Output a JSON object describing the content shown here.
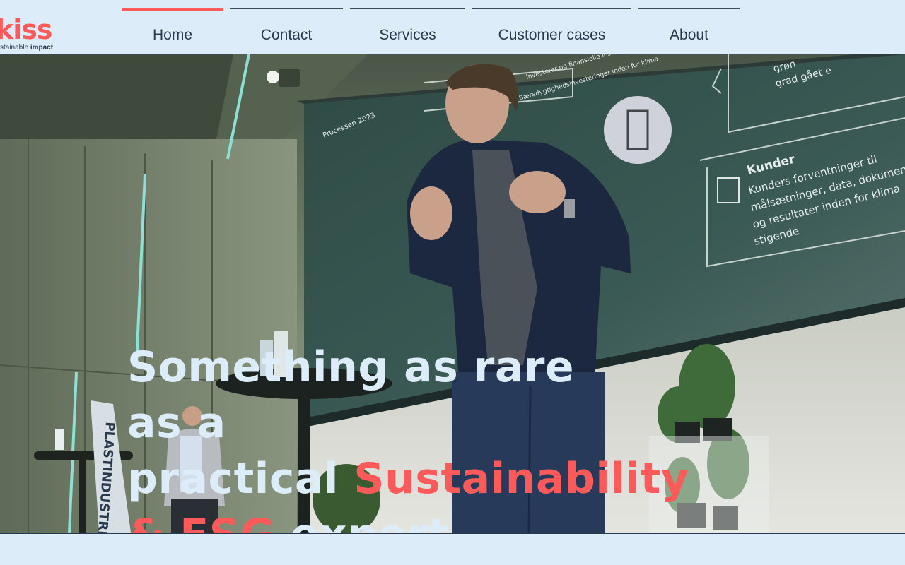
{
  "brand": {
    "logo_text": "kiss",
    "tagline_prefix": "stainable",
    "tagline_emphasis": "impact",
    "accent_color": "#ff5a5a",
    "text_color": "#2a3a4e",
    "background_color": "#dcecf9"
  },
  "nav": {
    "items": [
      {
        "label": "Home",
        "active": true
      },
      {
        "label": "Contact",
        "active": false
      },
      {
        "label": "Services",
        "active": false
      },
      {
        "label": "Customer cases",
        "active": false
      },
      {
        "label": "About",
        "active": false
      }
    ]
  },
  "hero": {
    "headline": {
      "line1": "Something as rare as a",
      "line2_plain": "practical ",
      "line2_accent": "Sustainability",
      "line3_accent": "& ESG",
      "line3_plain": " expert"
    },
    "screen": {
      "title": "Kunder",
      "body_line1": "Kunders forventninger til",
      "body_line2": "målsætninger, data, dokumen",
      "body_line3": "og resultater inden for klima",
      "body_line4": "stigende",
      "top_line1": "grøn",
      "top_line2": "grad gået e",
      "left_title": "Processen 2023",
      "mid_title": "Investorer og finansielle institutter",
      "mid_sub": "Bæredygtighedsinvesteringer inden for klima"
    },
    "banner_text": "PLASTINDUSTRIEN"
  }
}
